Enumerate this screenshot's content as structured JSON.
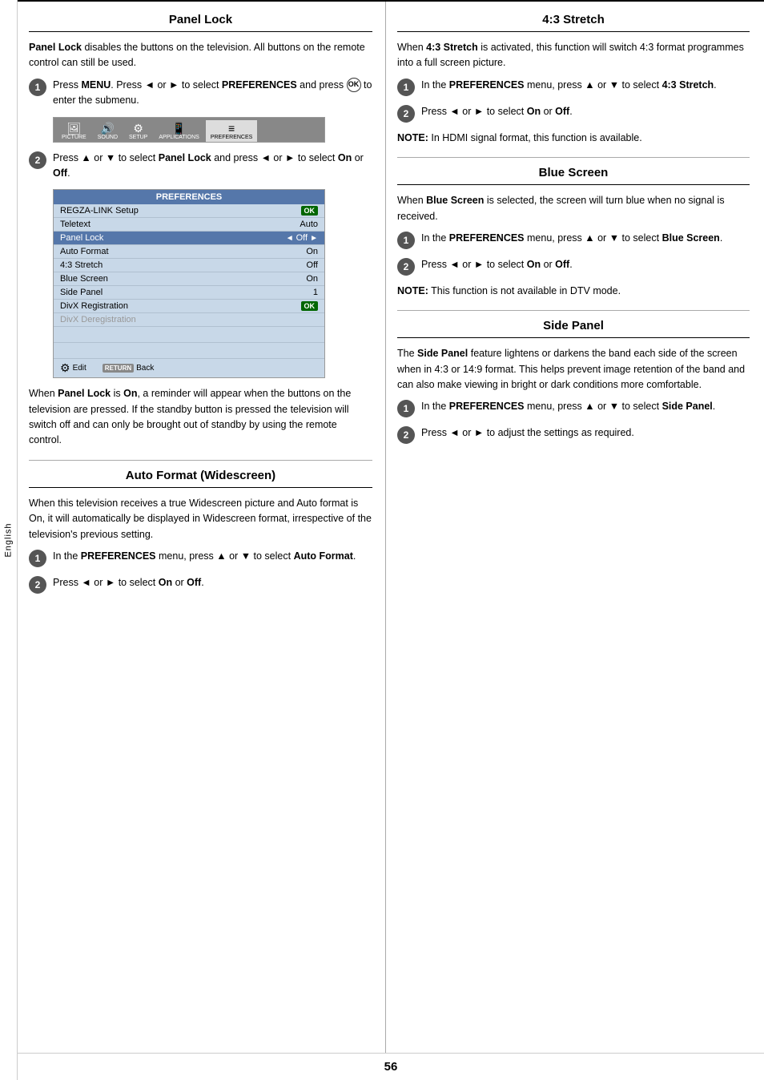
{
  "lang": "English",
  "page_number": "56",
  "left_column": {
    "panel_lock": {
      "title": "Panel Lock",
      "intro": "Panel Lock disables the buttons on the television. All buttons on the remote control can still be used.",
      "step1": {
        "num": "1",
        "text_before_menu": "Press ",
        "bold1": "MENU",
        "text_mid": ". Press ◄ or ► to select ",
        "bold2": "PREFERENCES",
        "text_end": " and press"
      },
      "step1_ok": "ok",
      "step1_suffix": "to enter the submenu.",
      "menu_tabs": [
        {
          "icon": "🖼",
          "label": "PICTURE",
          "active": false
        },
        {
          "icon": "🔊",
          "label": "SOUND",
          "active": false
        },
        {
          "icon": "⚙",
          "label": "SETUP",
          "active": false
        },
        {
          "icon": "📱",
          "label": "APPLICATIONS",
          "active": false
        },
        {
          "icon": "≡",
          "label": "PREFERENCES",
          "active": true
        }
      ],
      "step2": {
        "num": "2",
        "text": "Press ▲ or ▼ to select ",
        "bold1": "Panel Lock",
        "text2": " and press ◄ or ► to select ",
        "bold2": "On",
        "text3": " or ",
        "bold3": "Off",
        "text4": "."
      },
      "menu": {
        "header": "PREFERENCES",
        "rows": [
          {
            "label": "REGZA-LINK Setup",
            "value": "",
            "ok": true,
            "highlighted": false
          },
          {
            "label": "Teletext",
            "value": "Auto",
            "ok": false,
            "highlighted": false
          },
          {
            "label": "Panel Lock",
            "value": "Off",
            "arrows": true,
            "ok": false,
            "highlighted": true
          },
          {
            "label": "Auto Format",
            "value": "On",
            "ok": false,
            "highlighted": false
          },
          {
            "label": "4:3 Stretch",
            "value": "Off",
            "ok": false,
            "highlighted": false
          },
          {
            "label": "Blue Screen",
            "value": "On",
            "ok": false,
            "highlighted": false
          },
          {
            "label": "Side Panel",
            "value": "1",
            "ok": false,
            "highlighted": false
          },
          {
            "label": "DivX Registration",
            "value": "",
            "ok": true,
            "highlighted": false
          },
          {
            "label": "DivX Deregistration",
            "value": "",
            "ok": false,
            "highlighted": false,
            "disabled": true
          }
        ],
        "footer_edit": "Edit",
        "footer_back": "Back"
      },
      "reminder_text": "When Panel Lock is On, a reminder will appear when the buttons on the television are pressed. If the standby button is pressed the television will switch off and can only be brought out of standby by using the remote control."
    },
    "auto_format": {
      "title": "Auto Format (Widescreen)",
      "intro": "When this television receives a true Widescreen picture and Auto format is On, it will automatically be displayed in Widescreen format, irrespective of the television's previous setting.",
      "step1": {
        "num": "1",
        "text": "In the ",
        "bold1": "PREFERENCES",
        "text2": " menu, press ▲ or ▼ to select ",
        "bold2": "Auto Format",
        "text3": "."
      },
      "step2": {
        "num": "2",
        "text": "Press ◄ or ► to select ",
        "bold1": "On",
        "text2": " or ",
        "bold2": "Off",
        "text3": "."
      }
    }
  },
  "right_column": {
    "stretch43": {
      "title": "4:3 Stretch",
      "intro": "When 4:3 Stretch is activated, this function will switch 4:3 format programmes into a full screen picture.",
      "step1": {
        "num": "1",
        "text": "In the ",
        "bold1": "PREFERENCES",
        "text2": " menu, press ▲ or ▼ to select ",
        "bold2": "4:3 Stretch",
        "text3": "."
      },
      "step2": {
        "num": "2",
        "text": "Press ◄ or ► to select ",
        "bold1": "On",
        "text2": " or ",
        "bold2": "Off",
        "text3": "."
      },
      "note_label": "NOTE:",
      "note_text": " In HDMI signal format, this function is available."
    },
    "blue_screen": {
      "title": "Blue Screen",
      "intro": "When Blue Screen is selected, the screen will turn blue when no signal is received.",
      "step1": {
        "num": "1",
        "text": "In the ",
        "bold1": "PREFERENCES",
        "text2": " menu, press ▲ or ▼ to select ",
        "bold2": "Blue Screen",
        "text3": "."
      },
      "step2": {
        "num": "2",
        "text": "Press ◄ or ► to select ",
        "bold1": "On",
        "text2": " or ",
        "bold2": "Off",
        "text3": "."
      },
      "note_label": "NOTE:",
      "note_text": " This function is not available in DTV mode."
    },
    "side_panel": {
      "title": "Side Panel",
      "intro": "The Side Panel feature lightens or darkens the band each side of the screen when in 4:3 or 14:9 format. This helps prevent image retention of the band and can also make viewing in bright or dark conditions more comfortable.",
      "step1": {
        "num": "1",
        "text": "In the ",
        "bold1": "PREFERENCES",
        "text2": " menu, press ▲ or ▼ to select ",
        "bold2": "Side Panel",
        "text3": "."
      },
      "step2": {
        "num": "2",
        "text": "Press ◄ or ► to adjust the settings as required."
      }
    }
  }
}
